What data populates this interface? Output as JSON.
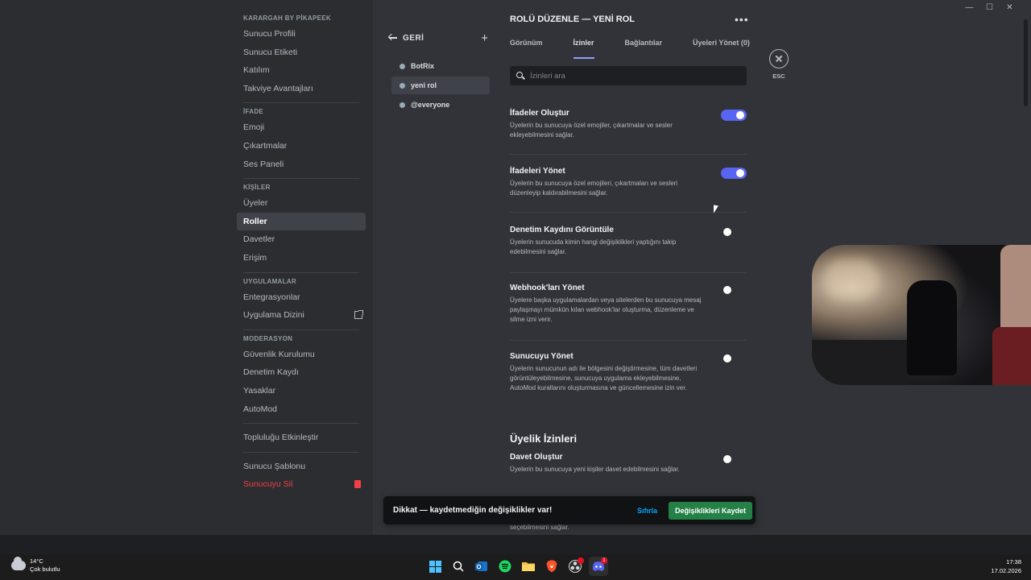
{
  "window": {
    "minimize": "—",
    "maximize": "☐",
    "close": "✕"
  },
  "sidebar": {
    "server_name": "KARARGAH BY PİKAPEEK",
    "group1": [
      "Sunucu Profili",
      "Sunucu Etiketi",
      "Katılım",
      "Takviye Avantajları"
    ],
    "cat_ifade": "İFADE",
    "group2": [
      "Emoji",
      "Çıkartmalar",
      "Ses Paneli"
    ],
    "cat_kisiler": "KİŞİLER",
    "group3": [
      "Üyeler",
      "Roller",
      "Davetler",
      "Erişim"
    ],
    "cat_uygulamalar": "UYGULAMALAR",
    "group4": [
      "Entegrasyonlar",
      "Uygulama Dizini"
    ],
    "cat_moderasyon": "MODERASYON",
    "group5": [
      "Güvenlik Kurulumu",
      "Denetim Kaydı",
      "Yasaklar",
      "AutoMod"
    ],
    "community": "Topluluğu Etkinleştir",
    "template": "Sunucu Şablonu",
    "delete": "Sunucuyu Sil"
  },
  "roles": {
    "back_label": "GERİ",
    "add_label": "+",
    "items": [
      "BotRix",
      "yeni rol",
      "@everyone"
    ]
  },
  "main": {
    "title": "ROLÜ DÜZENLE — YENİ ROL",
    "more": "•••",
    "tabs": [
      "Görünüm",
      "İzinler",
      "Bağlantılar",
      "Üyeleri Yönet (0)"
    ],
    "search_placeholder": "İzinleri ara",
    "permissions": [
      {
        "title": "İfadeler Oluştur",
        "desc": "Üyelerin bu sunucuya özel emojiler, çıkartmalar ve sesler ekleyebilmesini sağlar.",
        "enabled": true
      },
      {
        "title": "İfadeleri Yönet",
        "desc": "Üyelerin bu sunucuya özel emojileri, çıkartmaları ve sesleri düzenleyip kaldırabilmesini sağlar.",
        "enabled": true
      },
      {
        "title": "Denetim Kaydını Görüntüle",
        "desc": "Üyelerin sunucuda kimin hangi değişiklikleri yaptığını takip edebilmesini sağlar.",
        "enabled": false
      },
      {
        "title": "Webhook'ları Yönet",
        "desc": "Üyelere başka uygulamalardan veya sitelerden bu sunucuya mesaj paylaşmayı mümkün kılan webhook'lar oluşturma, düzenleme ve silme izni verir.",
        "enabled": false
      },
      {
        "title": "Sunucuyu Yönet",
        "desc": "Üyelerin sunucunun adı ile bölgesini değiştirmesine, tüm davetleri görüntüleyebilmesine, sunucuya uygulama ekleyebilmesine, AutoMod kurallarını oluşturmasına ve güncellemesine izin ver.",
        "enabled": false
      }
    ],
    "section_membership": "Üyelik İzinleri",
    "invite_perm": {
      "title": "Davet Oluştur",
      "desc": "Üyelerin bu sunucuya yeni kişiler davet edebilmesini sağlar.",
      "enabled": false
    },
    "below_text": "seçebilmesini sağlar."
  },
  "esc": {
    "label": "ESC"
  },
  "savebar": {
    "message": "Dikkat — kaydetmediğin değişiklikler var!",
    "reset": "Sıfırla",
    "save": "Değişiklikleri Kaydet"
  },
  "taskbar": {
    "temperature": "14°C",
    "weather": "Çok bulutlu",
    "time": "17:38",
    "date": "17.02.2026",
    "discord_badge": "1"
  },
  "colors": {
    "accent": "#5865f2",
    "save": "#248046",
    "danger": "#f23f43",
    "bg": "#313338",
    "sidebar": "#2b2d31"
  }
}
